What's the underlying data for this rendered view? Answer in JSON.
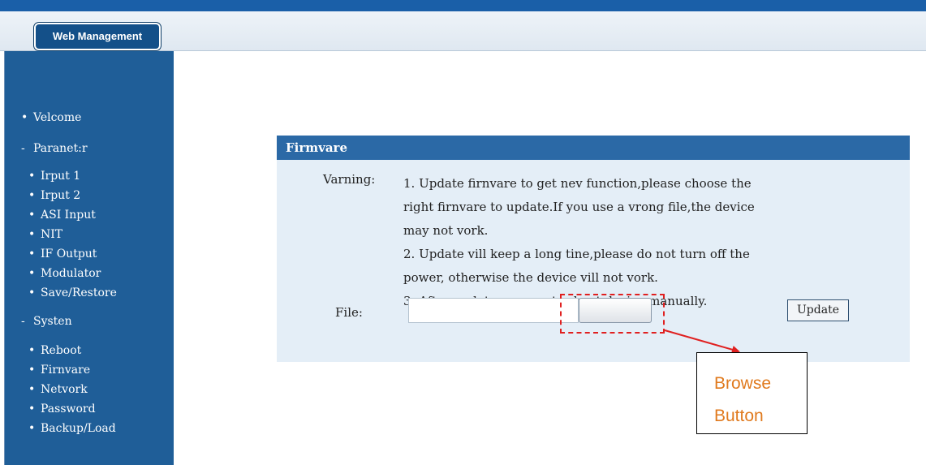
{
  "header": {
    "logo": "Web Management"
  },
  "sidebar": {
    "items": [
      {
        "bullet": "•",
        "label": "Velcome"
      },
      {
        "bullet": "-",
        "label": "Paranet:r"
      },
      {
        "bullet": "•",
        "label": "Irput 1"
      },
      {
        "bullet": "•",
        "label": "Irput 2"
      },
      {
        "bullet": "•",
        "label": "ASI Input"
      },
      {
        "bullet": "•",
        "label": "NIT"
      },
      {
        "bullet": "•",
        "label": "IF Output"
      },
      {
        "bullet": "•",
        "label": "Modulator"
      },
      {
        "bullet": "•",
        "label": "Save/Restore"
      },
      {
        "bullet": "-",
        "label": "Systen"
      },
      {
        "bullet": "•",
        "label": "Reboot"
      },
      {
        "bullet": "•",
        "label": "Firnvare"
      },
      {
        "bullet": "•",
        "label": "Netvork"
      },
      {
        "bullet": "•",
        "label": "Password"
      },
      {
        "bullet": "•",
        "label": "Backup/Load"
      }
    ]
  },
  "panel": {
    "title": "Firmvare",
    "warning_label": "Varning:",
    "warning_lines": [
      "1. Update firnvare to get nev function,please choose the",
      "right firnvare to update.If you use a vrong file,the device",
      "may not vork.",
      "2. Update vill keep a long tine,please do not turn off the",
      "power, otherwise the device vill not vork.",
      "3. After update,you must reboot device manually."
    ],
    "file_label": "File:",
    "file_value": "",
    "update_label": "Update"
  },
  "annotation": {
    "callout_line1": "Browse",
    "callout_line2": "Button",
    "color": "#e02020"
  }
}
